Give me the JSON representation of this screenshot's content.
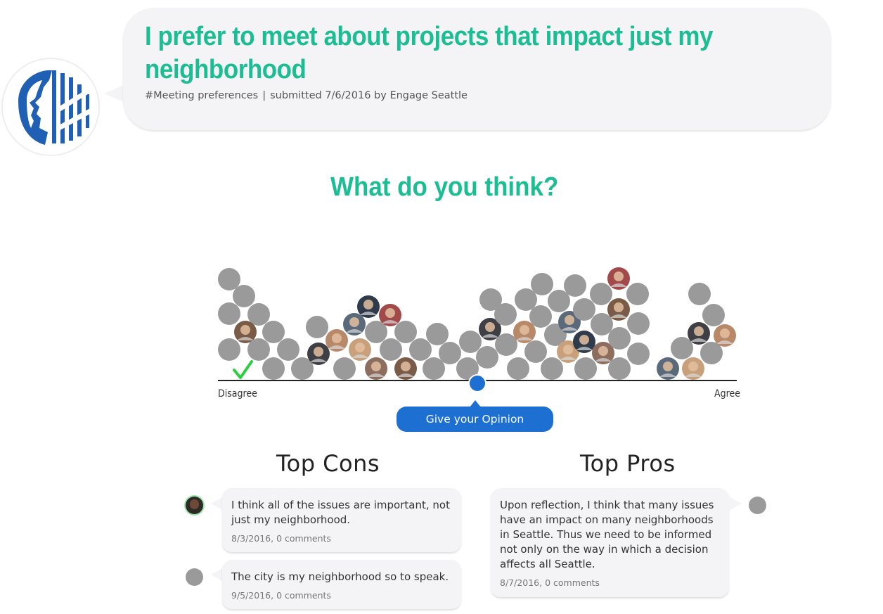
{
  "post": {
    "title": "I prefer to meet about projects that impact just my neighborhood",
    "tag": "#Meeting preferences",
    "separator": "|",
    "submitted": "submitted 7/6/2016 by Engage Seattle",
    "author_icon": "seattle-logo-icon",
    "brand_color": "#1dbd94"
  },
  "opinion": {
    "heading": "What do you think?",
    "disagree_label": "Disagree",
    "agree_label": "Agree",
    "button_label": "Give your Opinion",
    "slider_value": 0.5,
    "button_color": "#1d6fd1",
    "check_color": "#2ecc40"
  },
  "cons": {
    "title": "Top Cons",
    "items": [
      {
        "text": "I think all of the issues are important, not just my neighborhood.",
        "date": "8/3/2016, 0 comments"
      },
      {
        "text": "The city is my neighborhood so to speak.",
        "date": "9/5/2016, 0 comments"
      }
    ]
  },
  "pros": {
    "title": "Top Pros",
    "items": [
      {
        "text": "Upon reflection, I think that many issues have an impact on many neighborhoods in Seattle. Thus we need to be informed not only on the way in which a decision affects all Seattle.",
        "date": "8/7/2016, 0 comments"
      }
    ]
  }
}
